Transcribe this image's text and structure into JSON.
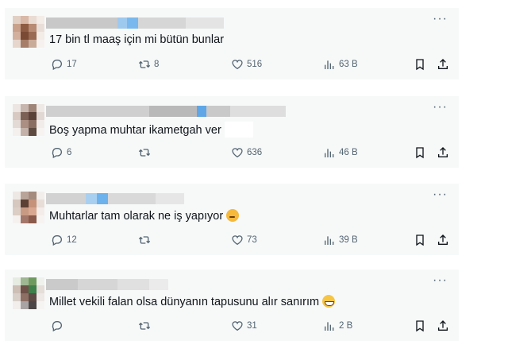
{
  "tweets": [
    {
      "text": "17 bin tl maaş için mi bütün bunlar",
      "replies": "17",
      "retweets": "8",
      "likes": "516",
      "views": "63 B",
      "emoji": ""
    },
    {
      "text": "Boş yapma muhtar ikametgah ver",
      "replies": "6",
      "retweets": "",
      "likes": "636",
      "views": "46 B",
      "emoji": ""
    },
    {
      "text": "Muhtarlar tam olarak ne iş yapıyor",
      "replies": "12",
      "retweets": "",
      "likes": "73",
      "views": "39 B",
      "emoji": "thinking-face"
    },
    {
      "text": "Millet vekili falan olsa dünyanın tapusunu alır sanırım",
      "replies": "",
      "retweets": "",
      "likes": "31",
      "views": "2 B",
      "emoji": "grinning-face"
    }
  ],
  "more_label": "···",
  "icons": {
    "reply": "reply-icon",
    "retweet": "retweet-icon",
    "like": "heart-icon",
    "views": "views-icon",
    "bookmark": "bookmark-icon",
    "share": "share-icon"
  },
  "colors": {
    "card_bg": "#f7f9f9",
    "text": "#0f1419",
    "muted": "#536471"
  }
}
